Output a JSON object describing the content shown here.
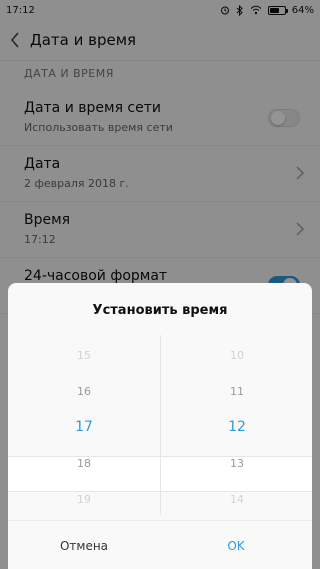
{
  "status_bar": {
    "time": "17:12",
    "battery_text": "64%",
    "battery_level": 0.64,
    "icons": [
      "bluetooth-icon",
      "wifi-icon",
      "alarm-icon"
    ]
  },
  "header": {
    "back_icon": "chevron-left-icon",
    "title": "Дата и время"
  },
  "section_title": "ДАТА И ВРЕМЯ",
  "settings": {
    "network_time": {
      "label": "Дата и время сети",
      "sublabel": "Использовать время сети",
      "toggle_on": false
    },
    "date": {
      "label": "Дата",
      "value": "2 февраля 2018 г."
    },
    "time": {
      "label": "Время",
      "value": "17:12"
    },
    "format24": {
      "label": "24-часовой формат",
      "toggle_on": true
    }
  },
  "dialog": {
    "title": "Установить время",
    "hours": [
      "15",
      "16",
      "17",
      "18",
      "19"
    ],
    "minutes": [
      "10",
      "11",
      "12",
      "13",
      "14"
    ],
    "selected_hour": "17",
    "selected_minute": "12",
    "cancel_label": "Отмена",
    "ok_label": "OK"
  },
  "colors": {
    "accent": "#2f9bd9"
  }
}
